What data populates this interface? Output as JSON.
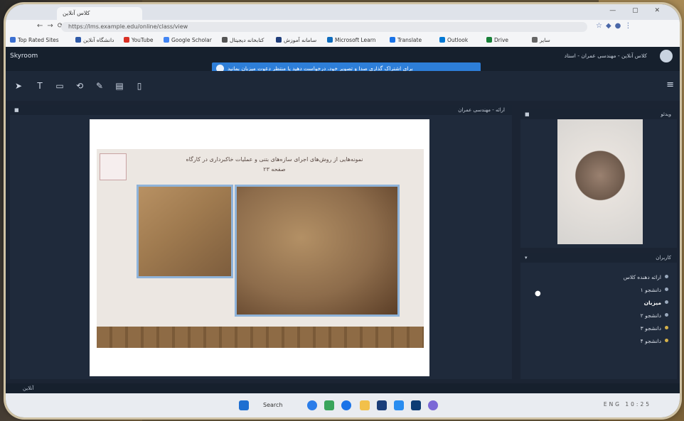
{
  "browser": {
    "tab_title": "کلاس آنلاین",
    "url": "https://lms.example.edu/online/class/view",
    "bookmarks": [
      {
        "label": "Top Rated Sites",
        "color": "#3b6fd1"
      },
      {
        "label": "دانشگاه آنلاین",
        "color": "#2f5aa8"
      },
      {
        "label": "YouTube",
        "color": "#d93025"
      },
      {
        "label": "Google Scholar",
        "color": "#4285f4"
      },
      {
        "label": "کتابخانه دیجیتال",
        "color": "#555555"
      },
      {
        "label": "سامانه آموزش",
        "color": "#1f3d7a"
      },
      {
        "label": "Microsoft Learn",
        "color": "#0f6cbd"
      },
      {
        "label": "Translate",
        "color": "#1a73e8"
      },
      {
        "label": "Outlook",
        "color": "#0078d4"
      },
      {
        "label": "Drive",
        "color": "#188038"
      },
      {
        "label": "سایر",
        "color": "#666666"
      }
    ]
  },
  "app": {
    "logo": "Skyroom",
    "title": "کلاس آنلاین - مهندسی عمران - استاد",
    "banner": "برای اشتراک گذاری صدا و تصویر خود، درخواست دهید یا منتظر دعوت میزبان بمانید",
    "toolbar_icons": [
      "pointer-icon",
      "text-icon",
      "board-icon",
      "share-icon",
      "pen-icon",
      "file-icon",
      "clipboard-icon"
    ]
  },
  "presentation": {
    "panel_title": "ارائه - مهندسی عمران",
    "slide_title": "نمونه‌هایی از روش‌های اجرای سازه‌های بتنی و عملیات خاکبرداری در کارگاه",
    "slide_subtitle": "صفحه ۲۳"
  },
  "video": {
    "panel_title": "ویدئو"
  },
  "users": {
    "panel_title": "کاربران",
    "list": [
      {
        "name": "ارائه دهنده کلاس",
        "bold": false
      },
      {
        "name": "دانشجو ۱",
        "bold": false
      },
      {
        "name": "میزبان",
        "bold": true
      },
      {
        "name": "دانشجو ۲",
        "bold": false
      },
      {
        "name": "دانشجو ۳",
        "bold": false
      },
      {
        "name": "دانشجو ۴",
        "bold": false
      }
    ]
  },
  "footer": {
    "status": "آنلاین"
  },
  "taskbar": {
    "search_label": "Search",
    "tray_text": "ENG 10:25"
  }
}
